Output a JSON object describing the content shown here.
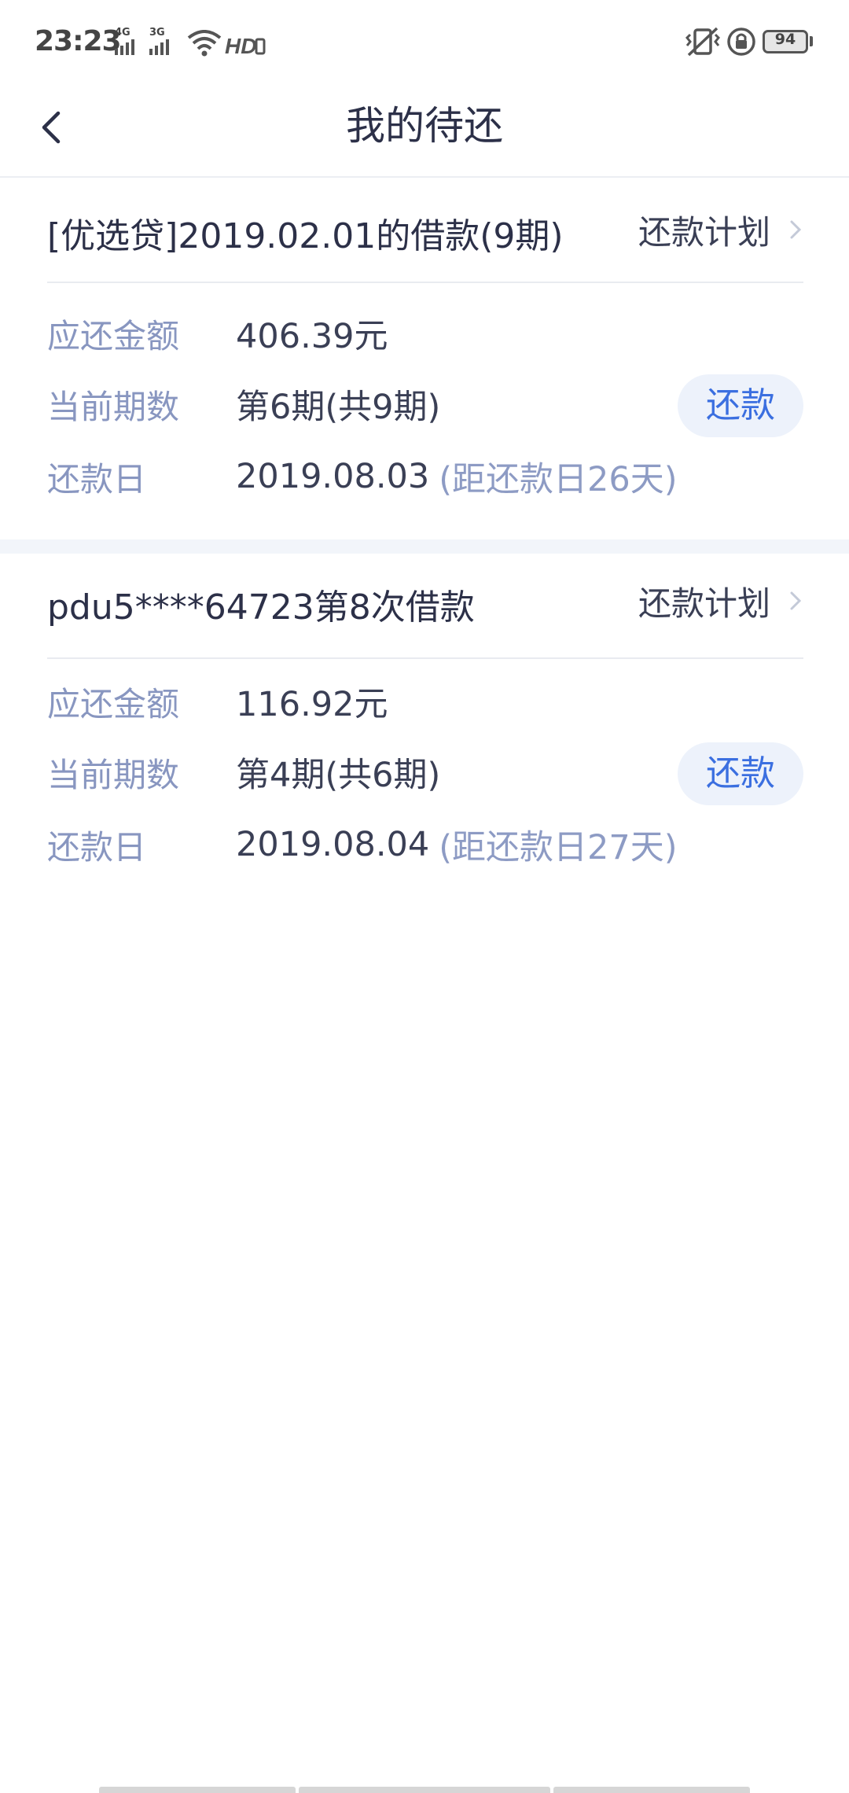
{
  "status_bar": {
    "time": "23:23",
    "signal1_label": "4G",
    "signal2_label": "3G",
    "hd_label": "HD",
    "battery": "94",
    "icons": [
      "signal-4g-icon",
      "signal-3g-icon",
      "wifi-icon",
      "hd-icon",
      "vibrate-icon",
      "rotation-lock-icon",
      "battery-icon"
    ]
  },
  "nav": {
    "title": "我的待还",
    "back_icon": "chevron-left-icon"
  },
  "loans": [
    {
      "title": "[优选贷]2019.02.01的借款(9期)",
      "plan_label": "还款计划",
      "amount_label": "应还金额",
      "amount_value": "406.39元",
      "period_label": "当前期数",
      "period_value": "第6期(共9期)",
      "due_label": "还款日",
      "due_value": "2019.08.03",
      "due_extra": "(距还款日26天)",
      "repay_label": "还款"
    },
    {
      "title": "pdu5****64723第8次借款",
      "plan_label": "还款计划",
      "amount_label": "应还金额",
      "amount_value": "116.92元",
      "period_label": "当前期数",
      "period_value": "第4期(共6期)",
      "due_label": "还款日",
      "due_value": "2019.08.04",
      "due_extra": "(距还款日27天)",
      "repay_label": "还款"
    }
  ],
  "colors": {
    "title_text": "#2c3048",
    "label_text": "#8896c0",
    "accent": "#3b6fe0",
    "button_bg": "#edf2fb",
    "band_bg": "#f2f5fa"
  }
}
